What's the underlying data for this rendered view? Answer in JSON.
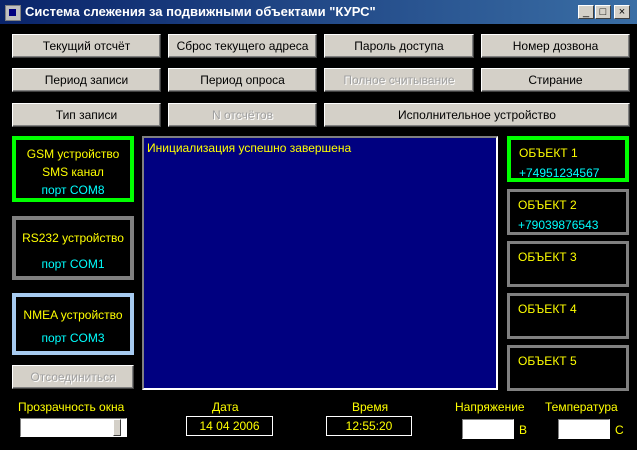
{
  "window": {
    "title": "Система слежения за подвижными объектами \"КУРС\"",
    "minimize": "_",
    "maximize": "□",
    "close": "×"
  },
  "buttons": {
    "current_report": "Текущий отсчёт",
    "reset_address": "Сброс текущего адреса",
    "access_password": "Пароль доступа",
    "dial_number": "Номер дозвона",
    "record_period": "Период записи",
    "poll_period": "Период опроса",
    "full_read": "Полное считывание",
    "erase": "Стирание",
    "record_type": "Тип записи",
    "n_reports": "N отсчётов",
    "actuator": "Исполнительное устройство",
    "disconnect": "Отсоединиться"
  },
  "devices": {
    "gsm": {
      "name": "GSM устройство",
      "channel": "SMS канал",
      "port": "порт COM8",
      "border": "#00ff00"
    },
    "rs232": {
      "name": "RS232 устройство",
      "port": "порт COM1",
      "border": "#808080"
    },
    "nmea": {
      "name": "NMEA устройство",
      "port": "порт COM3",
      "border": "#a6caf0"
    }
  },
  "log": {
    "message": "Инициализация успешно завершена"
  },
  "objects": [
    {
      "name": "ОБЪЕКТ 1",
      "phone": "+74951234567",
      "border": "#00ff00"
    },
    {
      "name": "ОБЪЕКТ 2",
      "phone": "+79039876543",
      "border": "#808080"
    },
    {
      "name": "ОБЪЕКТ 3",
      "phone": "",
      "border": "#808080"
    },
    {
      "name": "ОБЪЕКТ 4",
      "phone": "",
      "border": "#808080"
    },
    {
      "name": "ОБЪЕКТ 5",
      "phone": "",
      "border": "#808080"
    }
  ],
  "status": {
    "transparency_label": "Прозрачность окна",
    "transparency_level": 0.95,
    "date_label": "Дата",
    "date_value": "14 04 2006",
    "time_label": "Время",
    "time_value": "12:55:20",
    "voltage_label": "Напряжение",
    "voltage_unit": "В",
    "temperature_label": "Температура",
    "temperature_unit": "С"
  }
}
